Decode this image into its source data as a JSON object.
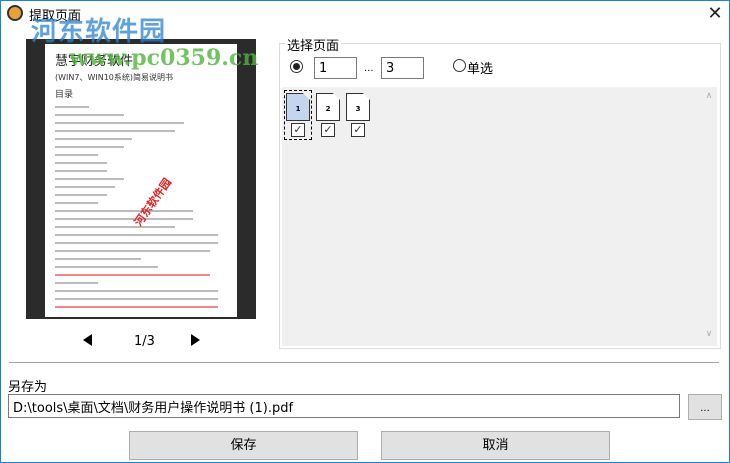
{
  "window": {
    "title": "提取页面",
    "close": "✕"
  },
  "watermark": {
    "name": "河东软件园",
    "url": "www.pc0359.cn"
  },
  "preview": {
    "doc_title": "慧宇财务软件",
    "doc_subtitle": "(WIN7、WIN10系统)简易说明书",
    "doc_heading": "目录",
    "stamp": "河东软件园",
    "page_indicator": "1/3"
  },
  "select_pages": {
    "label": "选择页面",
    "range_from": "1",
    "range_sep": "...",
    "range_to": "3",
    "single_label": "单选",
    "range_selected": true,
    "pages": [
      {
        "num": "1",
        "checked": true,
        "selected": true
      },
      {
        "num": "2",
        "checked": true,
        "selected": false
      },
      {
        "num": "3",
        "checked": true,
        "selected": false
      }
    ]
  },
  "save_as": {
    "label": "另存为",
    "path": "D:\\tools\\桌面\\文档\\财务用户操作说明书 (1).pdf",
    "browse": "..."
  },
  "buttons": {
    "save": "保存",
    "cancel": "取消"
  }
}
